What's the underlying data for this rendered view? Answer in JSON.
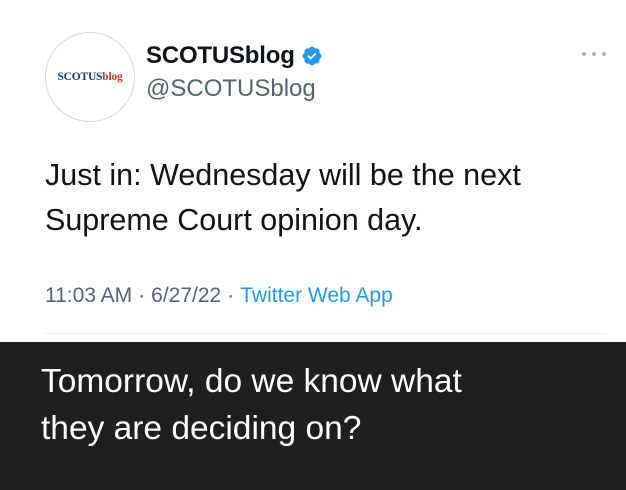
{
  "tweet": {
    "avatar_logo_part1": "SCOTUS",
    "avatar_logo_part2": "blog",
    "display_name": "SCOTUSblog",
    "handle": "@SCOTUSblog",
    "text_line1": "Just in: Wednesday will be the next",
    "text_line2": "Supreme Court opinion day.",
    "time": "11:03 AM",
    "date": "6/27/22",
    "separator": "·",
    "source": "Twitter Web App",
    "verified_color": "#1d9bf0"
  },
  "caption": {
    "line1": "Tomorrow, do we know what",
    "line2": "they are deciding on?"
  },
  "icons": {
    "verified": "verified-badge-icon",
    "more": "more-options-icon"
  }
}
